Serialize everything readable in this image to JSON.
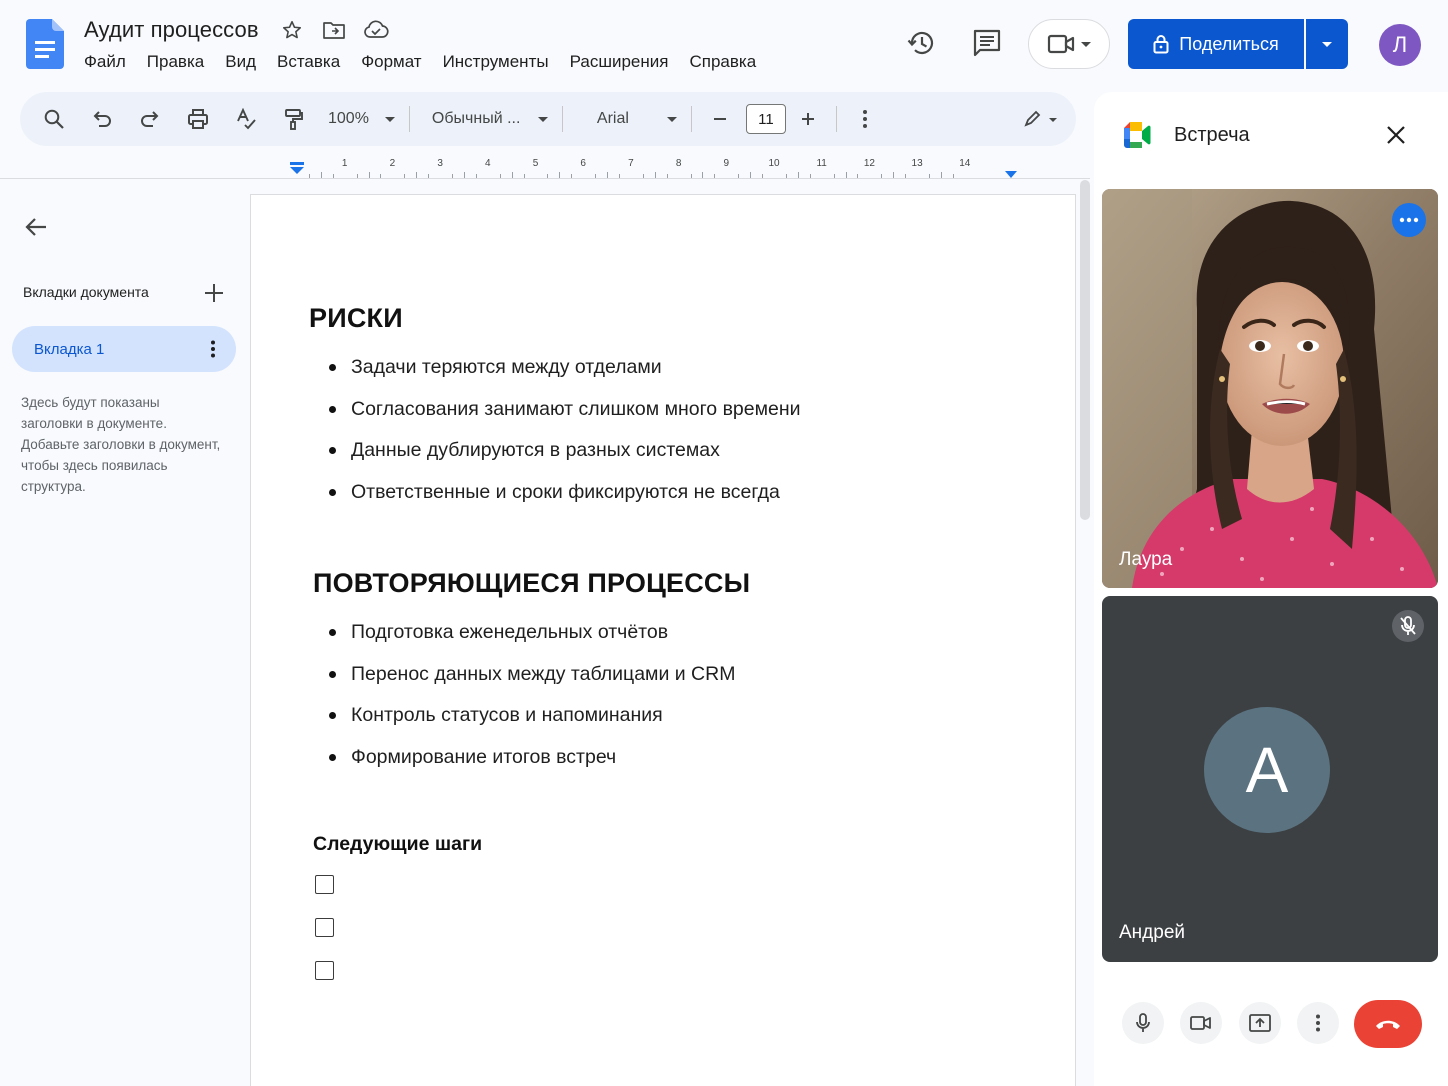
{
  "app": {
    "title": "Аудит процессов"
  },
  "menu": [
    "Файл",
    "Правка",
    "Вид",
    "Вставка",
    "Формат",
    "Инструменты",
    "Расширения",
    "Справка"
  ],
  "header": {
    "share_label": "Поделиться",
    "avatar_letter": "Л"
  },
  "toolbar": {
    "zoom": "100%",
    "style": "Обычный ...",
    "font": "Arial",
    "font_size": "11"
  },
  "ruler": {
    "numbers": [
      "1",
      "2",
      "3",
      "4",
      "5",
      "6",
      "7",
      "8",
      "9",
      "10",
      "11",
      "12",
      "13",
      "14"
    ]
  },
  "sidebar": {
    "tabs_label": "Вкладки документа",
    "tab_name": "Вкладка 1",
    "outline_hint": "Здесь будут показаны заголовки в документе. Добавьте заголовки в документ, чтобы здесь появилась структура."
  },
  "document": {
    "section1": {
      "heading": "РИСКИ",
      "items": [
        "Задачи теряются между отделами",
        "Согласования занимают слишком много времени",
        "Данные дублируются в разных системах",
        "Ответственные и сроки фиксируются не всегда"
      ]
    },
    "section2": {
      "heading": "ПОВТОРЯЮЩИЕСЯ ПРОЦЕССЫ",
      "items": [
        "Подготовка еженедельных отчётов",
        "Перенос данных между таблицами и CRM",
        "Контроль статусов и напоминания",
        "Формирование итогов встреч"
      ]
    },
    "section3": {
      "heading": "Следующие шаги",
      "checkboxes": 3
    }
  },
  "meet": {
    "title": "Встреча",
    "participants": [
      {
        "name": "Лаура",
        "video": true
      },
      {
        "name": "Андрей",
        "initial": "А",
        "muted": true
      }
    ]
  },
  "colors": {
    "accent": "#0b57d0",
    "hangup": "#ea4335",
    "avatar": "#7e57c2"
  }
}
